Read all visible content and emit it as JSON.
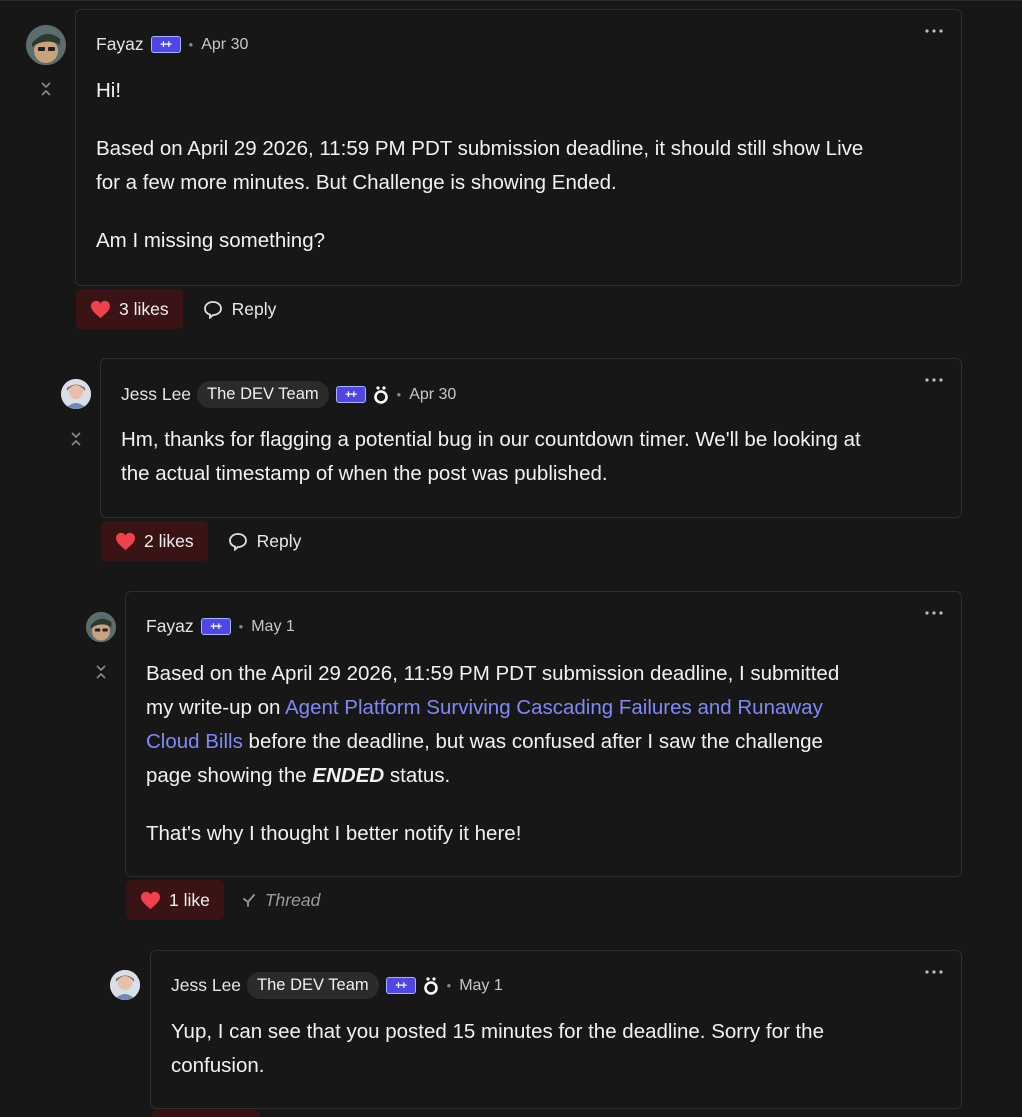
{
  "colors": {
    "background": "#171717",
    "card_border": "#2f2f2f",
    "link": "#8089f8",
    "like_bg": "#3a1414",
    "heart": "#f0424a",
    "badge": "#4f46e5"
  },
  "icons": {
    "collapse": "collapse-icon",
    "more": "more-horizontal-icon",
    "heart": "heart-icon",
    "reply": "comment-bubble-icon",
    "thread": "thread-arrow-icon",
    "plusplus": "dev-plusplus-badge",
    "moderator": "moderator-badge-icon"
  },
  "comments": [
    {
      "author": "Fayaz",
      "badge": "++",
      "date": "Apr 30",
      "paragraphs": [
        "Hi!",
        "Based on April 29 2026, 11:59 PM PDT submission deadline, it should still show Live",
        "for a few more minutes. But Challenge is showing Ended.",
        "Am I missing something?"
      ],
      "likes_label": "3 likes",
      "reply_label": "Reply"
    },
    {
      "author": "Jess Lee",
      "org": "The DEV Team",
      "badge": "++",
      "date": "Apr 30",
      "lines": [
        "Hm, thanks for flagging a potential bug in our countdown timer. We'll be looking at",
        "the actual timestamp of when the post was published."
      ],
      "likes_label": "2 likes",
      "reply_label": "Reply"
    },
    {
      "author": "Fayaz",
      "badge": "++",
      "date": "May 1",
      "line1": "Based on the April 29 2026, 11:59 PM PDT submission deadline, I submitted",
      "line2_pre": "my write-up on ",
      "link_part1": "Agent Platform Surviving Cascading Failures and Runaway",
      "link_part2": "Cloud Bills",
      "line3_post": " before the deadline, but was confused after I saw the challenge",
      "line4_pre": "page showing the ",
      "line4_em": "ENDED",
      "line4_post": " status.",
      "para2": "That's why I thought I better notify it here!",
      "likes_label": "1 like",
      "thread_label": "Thread"
    },
    {
      "author": "Jess Lee",
      "org": "The DEV Team",
      "badge": "++",
      "date": "May 1",
      "lines": [
        "Yup, I can see that you posted 15 minutes for the deadline. Sorry for the",
        "confusion."
      ]
    }
  ]
}
